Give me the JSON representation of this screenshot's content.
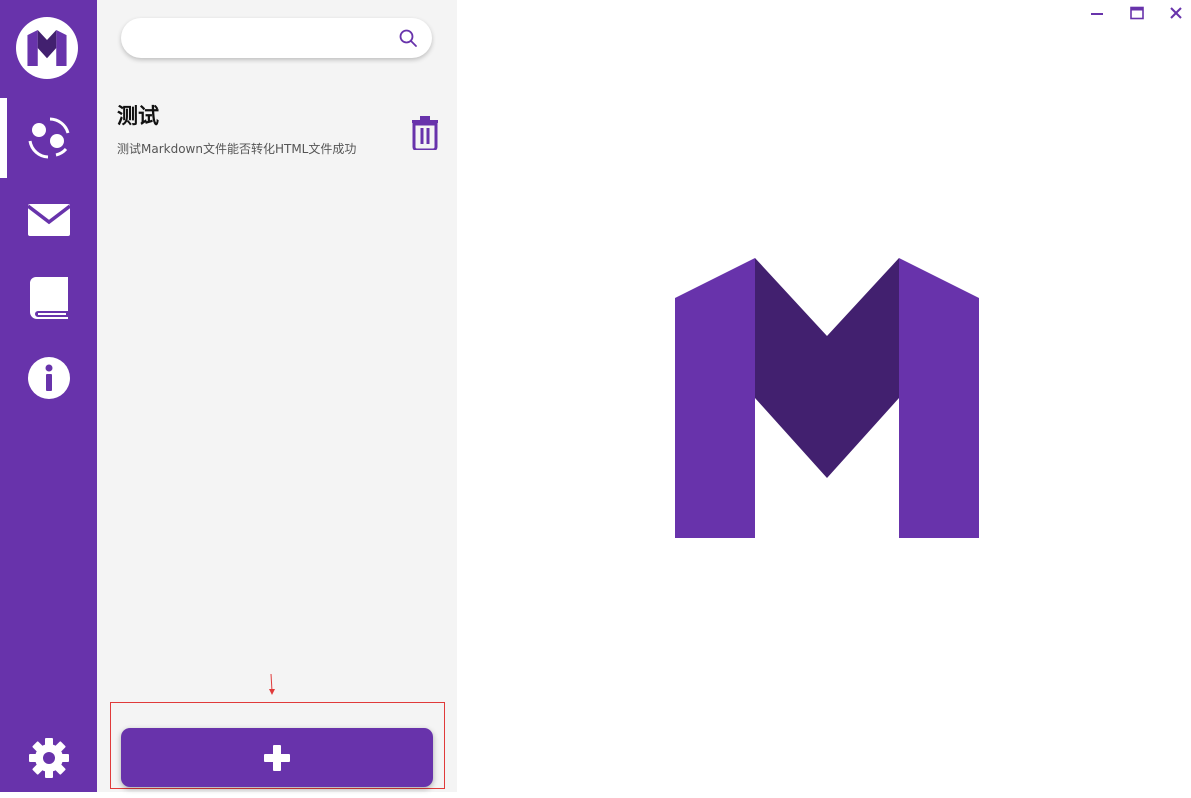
{
  "colors": {
    "brand": "#6833ab",
    "brand_dark": "#42206f",
    "panel_bg": "#f4f4f4",
    "highlight_border": "#e03a3a"
  },
  "nav": {
    "items": [
      {
        "name": "notes",
        "icon": "notes-share-icon",
        "active": true
      },
      {
        "name": "mail",
        "icon": "mail-icon",
        "active": false
      },
      {
        "name": "book",
        "icon": "book-icon",
        "active": false
      },
      {
        "name": "info",
        "icon": "info-icon",
        "active": false
      }
    ],
    "bottom": {
      "icon": "gear-icon"
    }
  },
  "search": {
    "value": "",
    "placeholder": ""
  },
  "notes": [
    {
      "title": "测试",
      "description": "测试Markdown文件能否转化HTML文件成功"
    }
  ],
  "add_button": {
    "icon": "plus-icon"
  },
  "window_controls": [
    "minimize",
    "maximize",
    "close"
  ]
}
